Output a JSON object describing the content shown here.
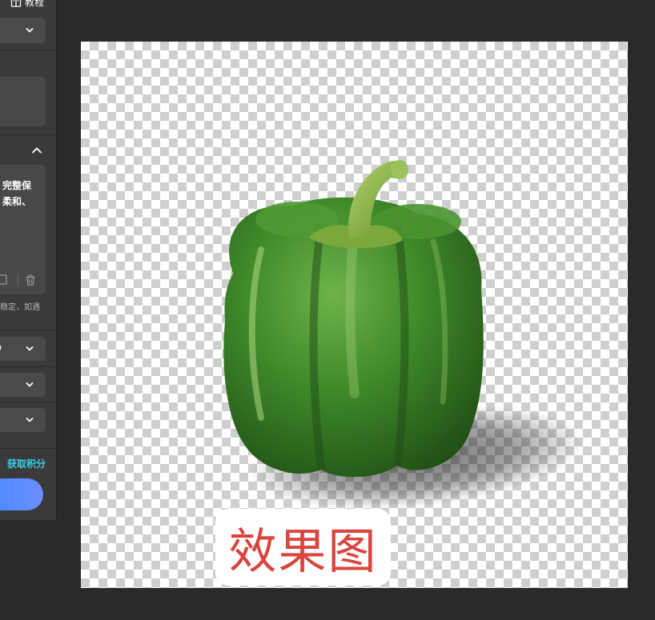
{
  "toolbar": {
    "tutorial_label": "教程"
  },
  "settings": {
    "model_select_1": {
      "value": ""
    },
    "prompt": {
      "lines": [
        "完整保",
        "柔和、"
      ]
    },
    "prompt_hint": "稳定，如遇",
    "model_select_2": {
      "value": "ro"
    },
    "model_select_3": {
      "value": ""
    },
    "model_select_4": {
      "value": ""
    }
  },
  "footer": {
    "get_points_label": "获取积分"
  },
  "canvas": {
    "watermark_text": "效果图"
  },
  "colors": {
    "panel_bg": "#3a3a3a",
    "app_bg": "#2a2a2a",
    "accent_link": "#35d2e6",
    "generate_button_gradient_start": "#3d8bff",
    "watermark_text": "#d9453f",
    "pepper_green": "#3f8a2a"
  },
  "icons": {
    "tutorial": "book-icon",
    "dropdown": "chevron-down-icon",
    "collapse": "chevron-up-icon",
    "copy": "copy-icon",
    "delete": "trash-icon"
  }
}
